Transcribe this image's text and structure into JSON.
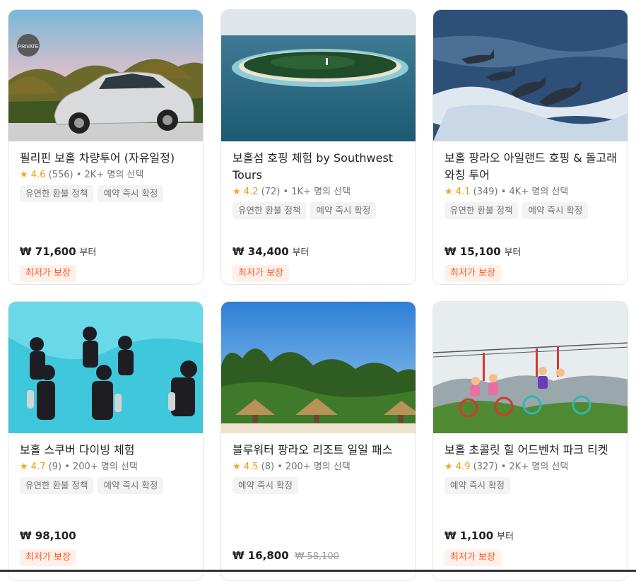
{
  "cards": [
    {
      "title": "필리핀 보홀 차량투어 (자유일정)",
      "score": "4.6",
      "reviews": "(556)",
      "booked": "• 2K+ 명의 선택",
      "tags": [
        "유연한 환불 정책",
        "예약 즉시 확정"
      ],
      "price": "₩ 71,600",
      "price_suffix": "부터",
      "original_price": "",
      "badge": "최저가 보장",
      "image_badge": "PRIVATE"
    },
    {
      "title": "보홀섬 호핑 체험 by Southwest Tours",
      "score": "4.2",
      "reviews": "(72)",
      "booked": "• 1K+ 명의 선택",
      "tags": [
        "유연한 환불 정책",
        "예약 즉시 확정"
      ],
      "price": "₩ 34,400",
      "price_suffix": "부터",
      "original_price": "",
      "badge": "최저가 보장"
    },
    {
      "title": "보홀 팡라오 아일랜드 호핑 & 돌고래 와칭 투어",
      "score": "4.1",
      "reviews": "(349)",
      "booked": "• 4K+ 명의 선택",
      "tags": [
        "유연한 환불 정책",
        "예약 즉시 확정"
      ],
      "price": "₩ 15,100",
      "price_suffix": "부터",
      "original_price": "",
      "badge": "최저가 보장"
    },
    {
      "title": "보홀 스쿠버 다이빙 체험",
      "score": "4.7",
      "reviews": "(9)",
      "booked": "• 200+ 명의 선택",
      "tags": [
        "유연한 환불 정책",
        "예약 즉시 확정"
      ],
      "price": "₩ 98,100",
      "price_suffix": "",
      "original_price": "",
      "badge": "최저가 보장"
    },
    {
      "title": "블루워터 팡라오 리조트 일일 패스",
      "score": "4.5",
      "reviews": "(8)",
      "booked": "• 200+ 명의 선택",
      "tags": [
        "예약 즉시 확정"
      ],
      "price": "₩ 16,800",
      "price_suffix": "",
      "original_price": "₩ 58,100",
      "badge": ""
    },
    {
      "title": "보홀 초콜릿 힐 어드벤처 파크 티켓",
      "score": "4.9",
      "reviews": "(327)",
      "booked": "• 2K+ 명의 선택",
      "tags": [
        "예약 즉시 확정"
      ],
      "price": "₩ 1,100",
      "price_suffix": "부터",
      "original_price": "",
      "badge": "최저가 보장"
    }
  ],
  "colors": {
    "star": "#f5a623",
    "badge_text": "#ff5722",
    "badge_bg": "#fff0ea"
  }
}
